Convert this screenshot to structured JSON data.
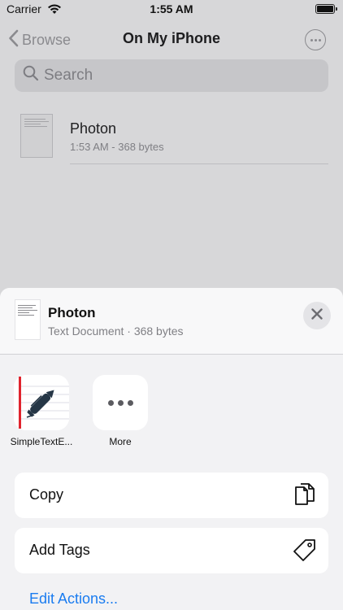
{
  "status_bar": {
    "carrier": "Carrier",
    "time": "1:55 AM"
  },
  "nav": {
    "back_label": "Browse",
    "title": "On My iPhone",
    "more_icon": "ellipsis-circle-icon"
  },
  "search": {
    "placeholder": "Search"
  },
  "files": [
    {
      "name": "Photon",
      "meta": "1:53 AM - 368 bytes"
    }
  ],
  "share_sheet": {
    "file_name": "Photon",
    "file_meta": "Text Document · 368 bytes",
    "apps": [
      {
        "label": "SimpleTextE...",
        "icon": "simpletexteditor-app-icon"
      },
      {
        "label": "More",
        "icon": "more-dots-icon"
      }
    ],
    "actions": [
      {
        "label": "Copy",
        "icon": "copy-icon"
      },
      {
        "label": "Add Tags",
        "icon": "tag-icon"
      }
    ],
    "edit_actions_label": "Edit Actions..."
  },
  "colors": {
    "accent": "#1a7cf0",
    "app_red": "#e0242e",
    "pen_dark": "#253646"
  }
}
